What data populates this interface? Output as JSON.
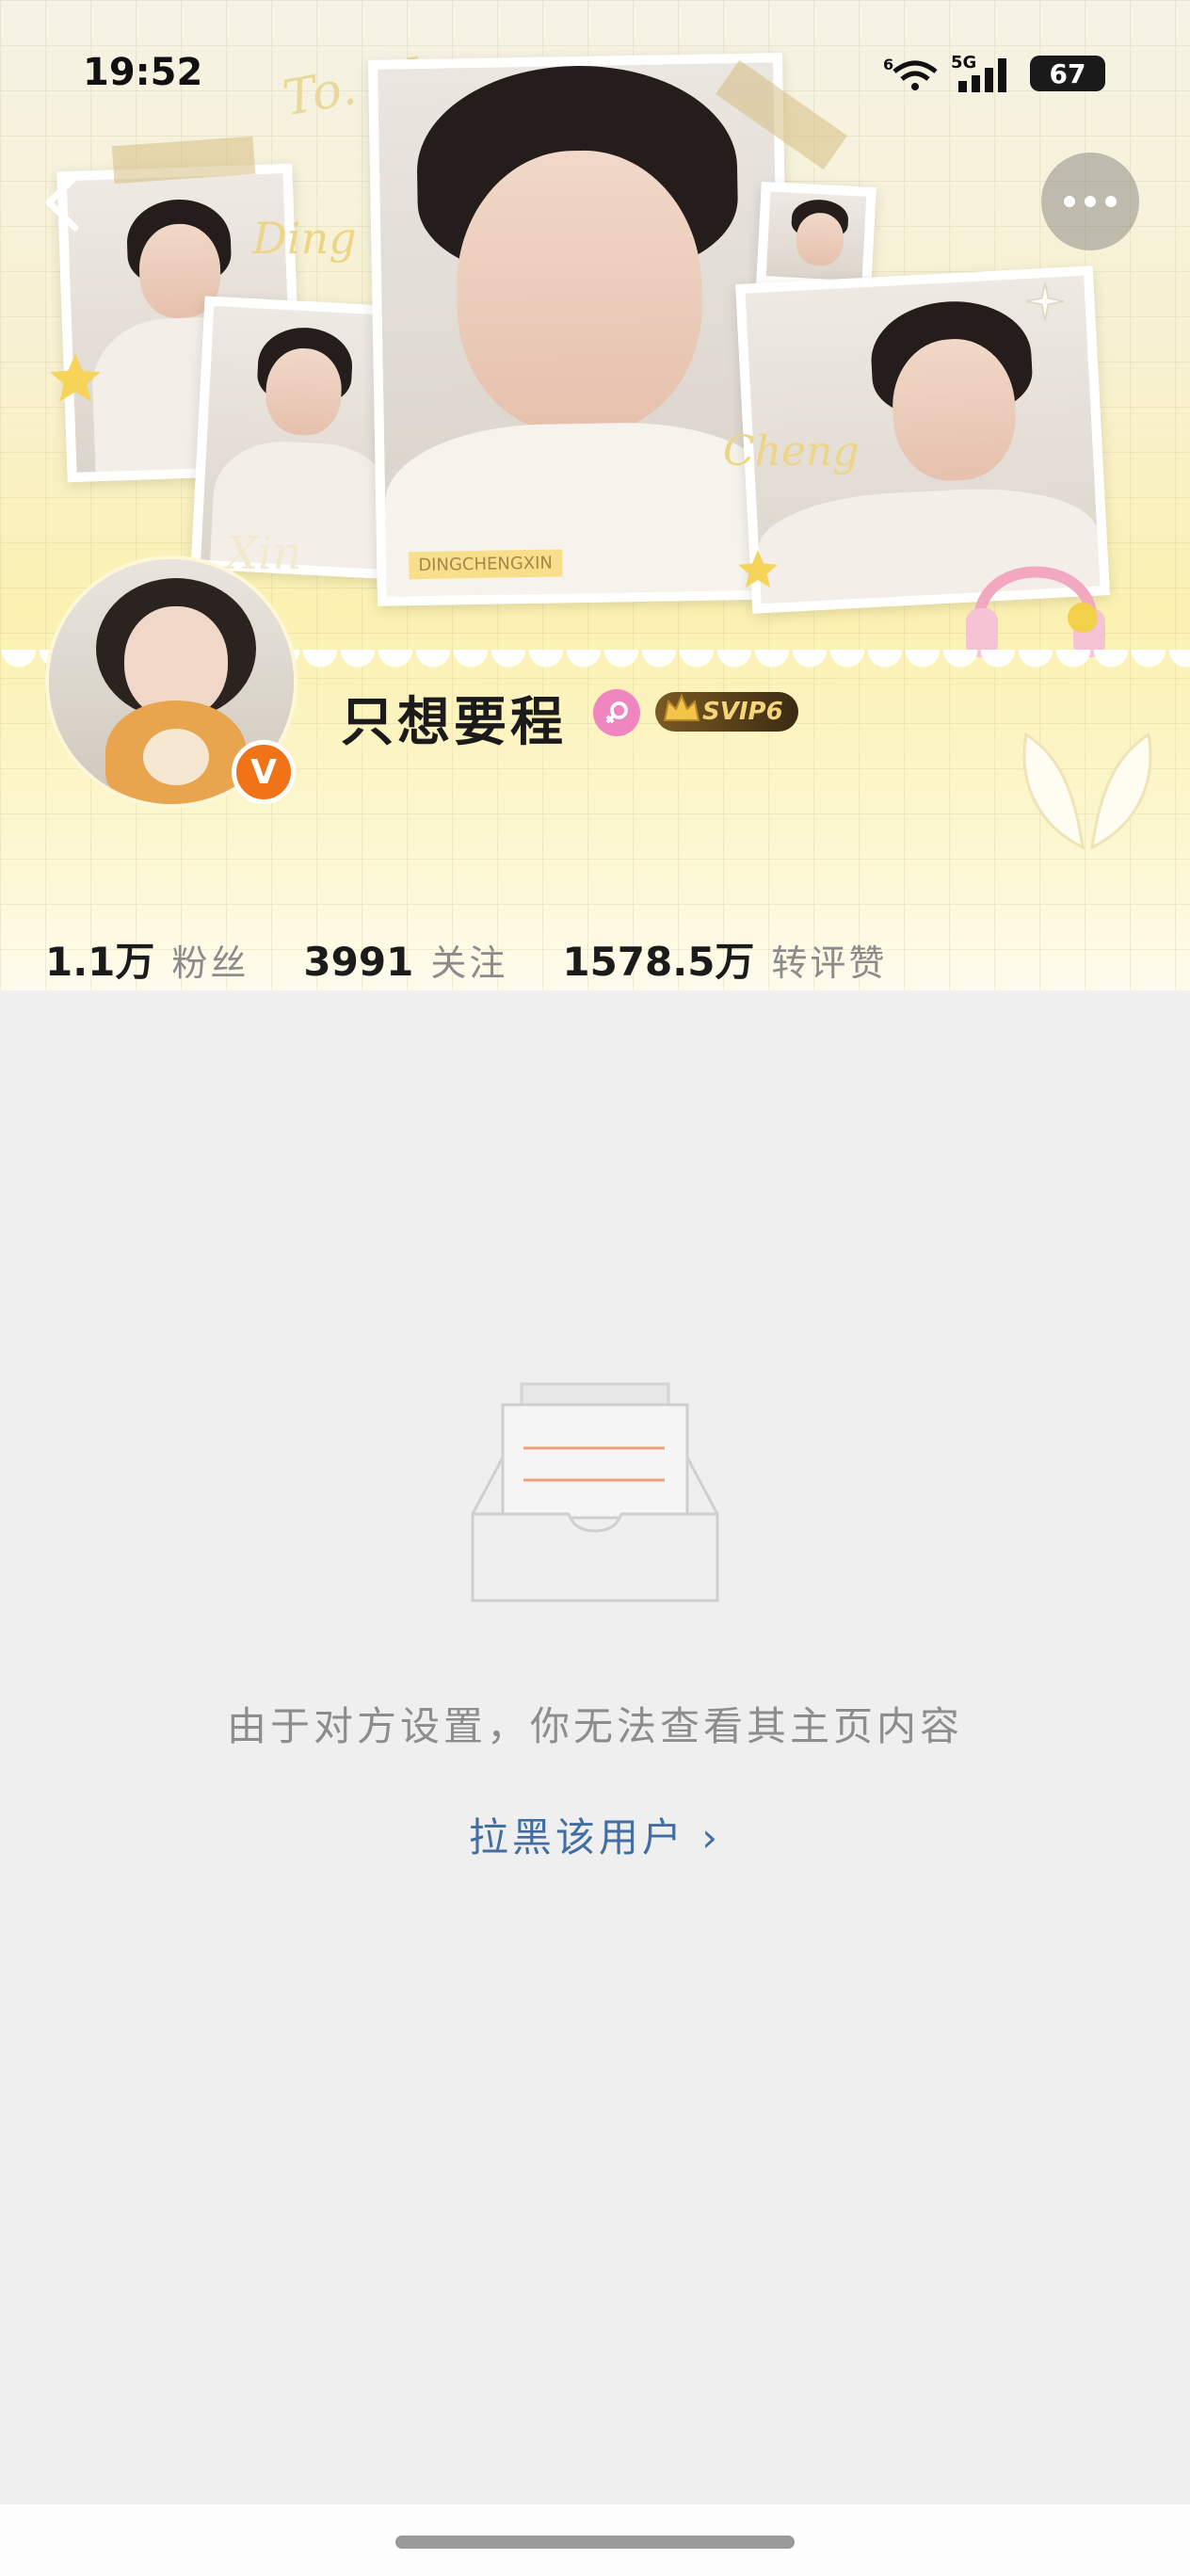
{
  "status_bar": {
    "time": "19:52",
    "network": "5G",
    "wifi_level": "6",
    "battery": "67"
  },
  "header": {
    "cover_words": [
      "Ding",
      "Cheng",
      "Xin"
    ],
    "cover_caption": "DINGCHENGXIN",
    "username": "只想要程",
    "vip_badge": "SVIP6",
    "verified_badge": "V"
  },
  "stats": [
    {
      "value": "1.1万",
      "label": "粉丝"
    },
    {
      "value": "3991",
      "label": "关注"
    },
    {
      "value": "1578.5万",
      "label": "转评赞"
    }
  ],
  "main": {
    "message": "由于对方设置，你无法查看其主页内容",
    "block_link": "拉黑该用户 ›"
  },
  "colors": {
    "accent_link": "#426ea3",
    "verified": "#f07318",
    "female_badge": "#ef86c0",
    "background": "#efefef"
  },
  "icons": [
    "back-icon",
    "more-icon",
    "wifi-icon",
    "signal-icon",
    "battery-icon",
    "female-icon",
    "crown-icon",
    "empty-inbox-icon",
    "chevron-right-icon"
  ]
}
